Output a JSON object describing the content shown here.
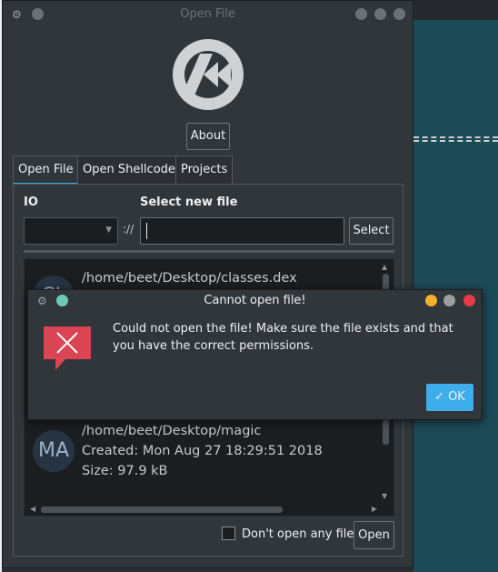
{
  "window": {
    "title": "Open File",
    "about_label": "About"
  },
  "tabs": [
    {
      "label": "Open File"
    },
    {
      "label": "Open Shellcode"
    },
    {
      "label": "Projects"
    }
  ],
  "open_file": {
    "io_label": "IO",
    "select_new_label": "Select new file",
    "io_value": "",
    "separator": "://",
    "path_value": "",
    "select_label": "Select"
  },
  "recent_files": [
    {
      "initials": "CL",
      "path": "/home/beet/Desktop/classes.dex",
      "created": "",
      "size": ""
    },
    {
      "initials": "MA",
      "path": "/home/beet/Desktop/magic",
      "created": "Created: Mon Aug 27 18:29:51 2018",
      "size": "Size: 97.9 kB"
    }
  ],
  "footer": {
    "dont_open_label": "Don't open any file",
    "open_label": "Open"
  },
  "dialog": {
    "title": "Cannot open file!",
    "message": "Could not open the file! Make sure the file exists and that you have the correct permissions.",
    "ok_label": "OK"
  },
  "colors": {
    "accent": "#3daee9",
    "error": "#da4453",
    "window_bg": "#31363b",
    "field_bg": "#1b1e20"
  }
}
